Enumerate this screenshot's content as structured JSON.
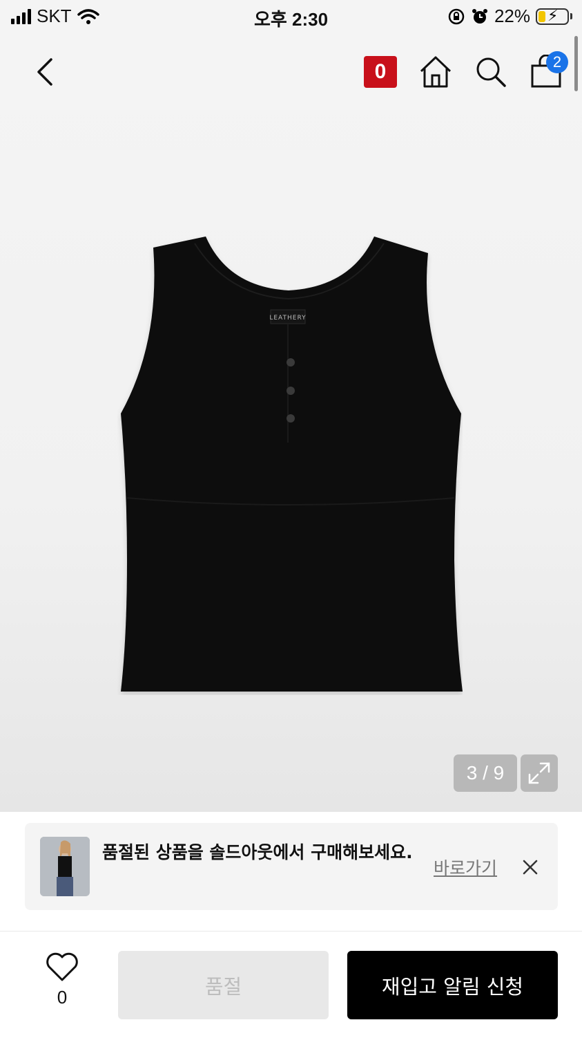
{
  "status_bar": {
    "carrier": "SKT",
    "time": "오후 2:30",
    "battery": "22%"
  },
  "header": {
    "brand_badge": "0",
    "cart_count": "2"
  },
  "gallery": {
    "counter": "3 / 9",
    "product_label": "LEATHERY"
  },
  "banner": {
    "text": "품절된 상품을 솔드아웃에서 구매해보세요.",
    "link": "바로가기"
  },
  "bottom_bar": {
    "like_count": "0",
    "sold_out_label": "품절",
    "restock_label": "재입고 알림 신청"
  },
  "colors": {
    "brand": "#c8101a",
    "badge": "#1a73e8",
    "primary_button": "#000000"
  },
  "icons": [
    "back-icon",
    "home-icon",
    "search-icon",
    "bag-icon",
    "expand-icon",
    "close-icon",
    "heart-icon"
  ]
}
